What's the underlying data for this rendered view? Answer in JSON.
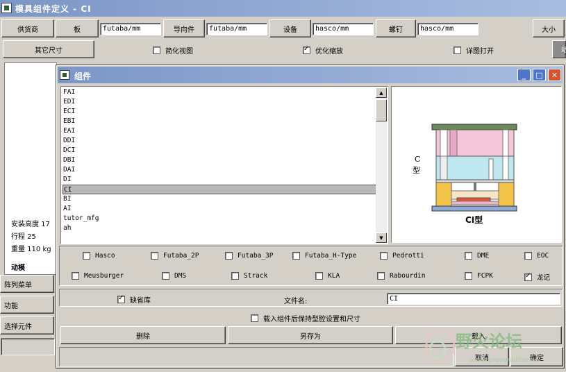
{
  "window": {
    "title": "模具组件定义 - CI"
  },
  "toolbar": {
    "supplier_label": "供货商",
    "plate_label": "板",
    "plate_value": "futaba/mm",
    "guide_label": "导向件",
    "guide_value": "futaba/mm",
    "equipment_label": "设备",
    "equipment_value": "hasco/mm",
    "screw_label": "螺钉",
    "screw_value": "hasco/mm",
    "size_label": "大小",
    "other_size_label": "其它尺寸",
    "simplified_view_label": "简化视图",
    "simplified_view_checked": false,
    "optimize_zoom_label": "优化缩放",
    "optimize_zoom_checked": true,
    "detail_open_label": "详图打开",
    "detail_open_checked": false,
    "clipped_label": "动"
  },
  "left_panel": {
    "install_height": "安装高度 17",
    "stroke": "行程 25",
    "weight": "重量 110 kg",
    "moving_mold": "动模",
    "array_menu": "阵列菜单",
    "function": "功能",
    "select_component": "选择元件"
  },
  "dialog": {
    "title": "组件",
    "min_glyph": "_",
    "max_glyph": "□",
    "close_glyph": "✕",
    "list_items": [
      "FAI",
      "EDI",
      "ECI",
      "EBI",
      "EAI",
      "DDI",
      "DCI",
      "DBI",
      "DAI",
      "DI",
      "CI",
      "BI",
      "AI",
      "tutor_mfg",
      "ah"
    ],
    "selected_index": 10,
    "scroll_up": "▲",
    "scroll_down": "▼",
    "preview": {
      "side_label_line1": "C",
      "side_label_line2": "型",
      "caption": "CI型"
    },
    "vendors_row1": [
      {
        "label": "Hasco",
        "checked": false
      },
      {
        "label": "Futaba_2P",
        "checked": false
      },
      {
        "label": "Futaba_3P",
        "checked": false
      },
      {
        "label": "Futaba_H-Type",
        "checked": false
      },
      {
        "label": "Pedrotti",
        "checked": false
      },
      {
        "label": "DME",
        "checked": false
      },
      {
        "label": "EOC",
        "checked": false
      }
    ],
    "vendors_row2": [
      {
        "label": "Meusburger",
        "checked": false
      },
      {
        "label": "DMS",
        "checked": false
      },
      {
        "label": "Strack",
        "checked": false
      },
      {
        "label": "KLA",
        "checked": false
      },
      {
        "label": "Rabourdin",
        "checked": false
      },
      {
        "label": "FCPK",
        "checked": false
      },
      {
        "label": "龙记",
        "checked": true
      }
    ],
    "default_lib_label": "缺省库",
    "default_lib_checked": true,
    "filename_label": "文件名:",
    "filename_value": "CI",
    "keep_cavity_label": "载入组件后保持型腔设置和尺寸",
    "keep_cavity_checked": false,
    "delete_label": "删除",
    "save_as_label": "另存为",
    "load_label": "载入",
    "cancel_label": "取消",
    "ok_label": "确定"
  },
  "watermark": {
    "text": "野火论坛",
    "url": "www.proewildfire.cn"
  },
  "colors": {
    "title_start": "#7b96c7",
    "title_end": "#a9bde0",
    "face": "#d4d0c8"
  }
}
